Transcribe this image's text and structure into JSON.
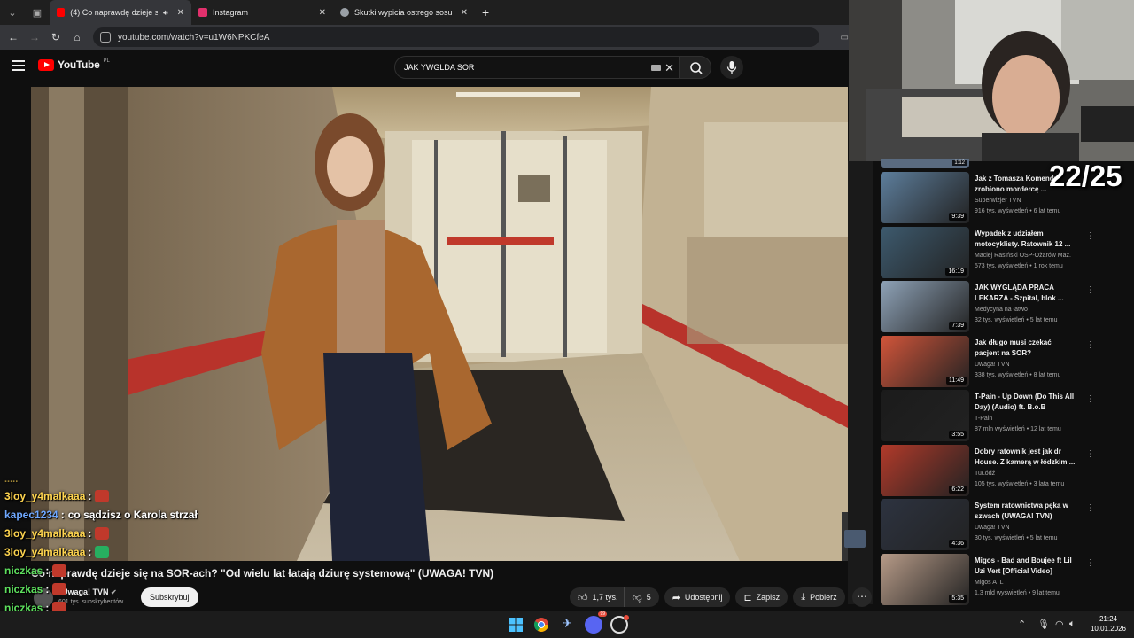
{
  "browser": {
    "tabs": [
      {
        "title": "(4) Co naprawdę dzieje się",
        "favicon_color": "#ff0000",
        "active": true
      },
      {
        "title": "Instagram",
        "favicon_color": "#e1306c",
        "active": false
      },
      {
        "title": "Skutki wypicia ostrego sosu",
        "favicon_color": "#9aa0a6",
        "active": false
      }
    ],
    "new_tab": "+",
    "url": "youtube.com/watch?v=u1W6NPKCfeA"
  },
  "youtube": {
    "logo": "YouTube",
    "logo_region": "PL",
    "search_value": "JAK YWGLDA SOR"
  },
  "video": {
    "title": "Co naprawdę dzieje się na SOR-ach? \"Od wielu lat łatają dziurę systemową\" (UWAGA! TVN)",
    "channel": "Uwaga! TVN",
    "subscribers": "601 tys. subskrybentów",
    "subscribe_label": "Subskrybuj",
    "likes": "1,7 tys.",
    "dislikes": "5",
    "share_label": "Udostępnij",
    "save_label": "Zapisz",
    "download_label": "Pobierz"
  },
  "chat": [
    {
      "user": "3loy_y4malkaaa",
      "color": "#ffd54f",
      "text": "",
      "emote": "#c0392b"
    },
    {
      "user": "kapec1234",
      "color": "#6fa8ff",
      "text": "co sądzisz o Karola strzał",
      "emote": ""
    },
    {
      "user": "3loy_y4malkaaa",
      "color": "#ffd54f",
      "text": "",
      "emote": "#c0392b"
    },
    {
      "user": "3loy_y4malkaaa",
      "color": "#ffd54f",
      "text": "",
      "emote": "#27ae60"
    },
    {
      "user": "niczkas",
      "color": "#5ee05e",
      "text": "",
      "emote": "#c0392b"
    },
    {
      "user": "niczkas",
      "color": "#5ee05e",
      "text": "",
      "emote": "#c0392b"
    },
    {
      "user": "niczkas",
      "color": "#5ee05e",
      "text": "",
      "emote": "#c0392b"
    },
    {
      "user": "nstl0911",
      "color": "#ffffff",
      "text": "",
      "emote": "#c0392b"
    }
  ],
  "counter": "22/25",
  "recommendations": [
    {
      "title": "Jak z Tomasza Komendy zrobiono mordercę ...",
      "channel": "Superwizjer TVN",
      "meta": "916 tys. wyświetleń • 6 lat temu",
      "duration": "9:39",
      "thumb_color": "#5d7e9c"
    },
    {
      "title": "Wypadek z udziałem motocyklisty. Ratownik 12 ...",
      "channel": "Maciej Rasiński OSP-Ożarów Maz.",
      "meta": "573 tys. wyświetleń • 1 rok temu",
      "duration": "16:19",
      "thumb_color": "#3d5a6e"
    },
    {
      "title": "JAK WYGLĄDA PRACA LEKARZA - Szpital, blok ...",
      "channel": "Medycyna na łatwo",
      "meta": "32 tys. wyświetleń • 5 lat temu",
      "duration": "7:39",
      "thumb_color": "#8fa3b8"
    },
    {
      "title": "Jak długo musi czekać pacjent na SOR? Skandaliczna rozmo...",
      "channel": "Uwaga! TVN",
      "meta": "338 tys. wyświetleń • 8 lat temu",
      "duration": "11:49",
      "thumb_color": "#d2553a"
    },
    {
      "title": "T-Pain - Up Down (Do This All Day) (Audio) ft. B.o.B",
      "channel": "T-Pain",
      "meta": "87 mln wyświetleń • 12 lat temu",
      "duration": "3:55",
      "thumb_color": "#1b1b1b"
    },
    {
      "title": "Dobry ratownik jest jak dr House. Z kamerą w łódzkim ...",
      "channel": "TuŁódź",
      "meta": "105 tys. wyświetleń • 3 lata temu",
      "duration": "6:22",
      "thumb_color": "#b23a2a"
    },
    {
      "title": "System ratownictwa pęka w szwach (UWAGA! TVN)",
      "channel": "Uwaga! TVN",
      "meta": "30 tys. wyświetleń • 5 lat temu",
      "duration": "4:36",
      "thumb_color": "#2d3340"
    },
    {
      "title": "Migos - Bad and Boujee ft Lil Uzi Vert [Official Video]",
      "channel": "Migos ATL",
      "meta": "1,3 mld wyświetleń • 9 lat temu",
      "duration": "5:35",
      "thumb_color": "#b79b88"
    }
  ],
  "partial_thumb_duration": "1:12",
  "taskbar": {
    "time": "21:24",
    "date": "10.01.2026",
    "notification_badge": "99"
  }
}
